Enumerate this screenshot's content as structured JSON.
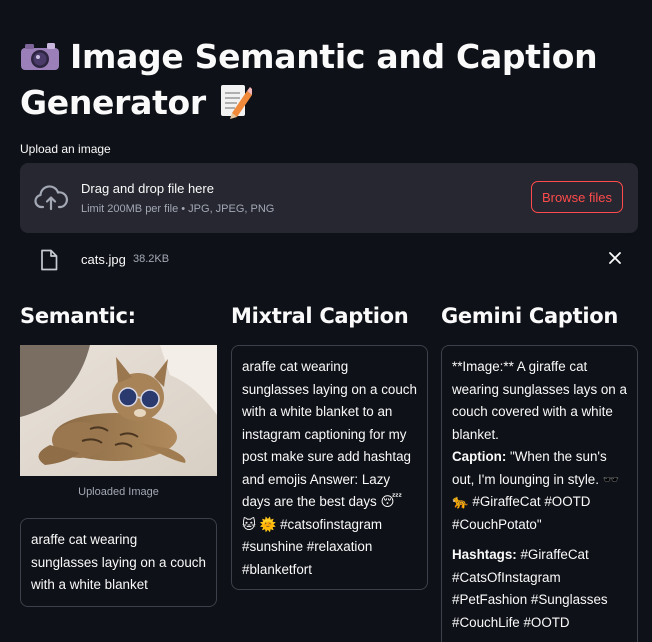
{
  "header": {
    "title_icon": "camera-emoji",
    "title_text": "Image Semantic and Caption Generator",
    "title_trail_icon": "memo-emoji"
  },
  "uploader": {
    "label": "Upload an image",
    "drag_text": "Drag and drop file here",
    "limit_text": "Limit 200MB per file • JPG, JPEG, PNG",
    "browse_label": "Browse files",
    "file": {
      "name": "cats.jpg",
      "size": "38.2KB"
    }
  },
  "semantic": {
    "heading": "Semantic:",
    "image_caption": "Uploaded Image",
    "text": "araffe cat wearing sunglasses laying on a couch with a white blanket"
  },
  "mixtral": {
    "heading": "Mixtral Caption",
    "text": "araffe cat wearing sunglasses laying on a couch with a white blanket to an instagram captioning for my post make sure add hashtag and emojis Answer: Lazy days are the best days 😴 🐱 🌞 #catsofinstagram #sunshine #relaxation #blanketfort"
  },
  "gemini": {
    "heading": "Gemini Caption",
    "line1": "**Image:** A giraffe cat wearing sunglasses lays on a couch covered with a white blanket.",
    "caption_label": "Caption:",
    "caption_text": " \"When the sun's out, I'm lounging in style. 🕶️ 🐆 #GiraffeCat #OOTD #CouchPotato\"",
    "hashtags_label": "Hashtags:",
    "hashtags_text": " #GiraffeCat #CatsOfInstagram #PetFashion #Sunglasses #CouchLife #OOTD"
  },
  "colors": {
    "background": "#0e1117",
    "panel": "#262730",
    "accent": "#ff4b4b",
    "muted_text": "#a3a8b4",
    "border": "#3d3f4a"
  }
}
